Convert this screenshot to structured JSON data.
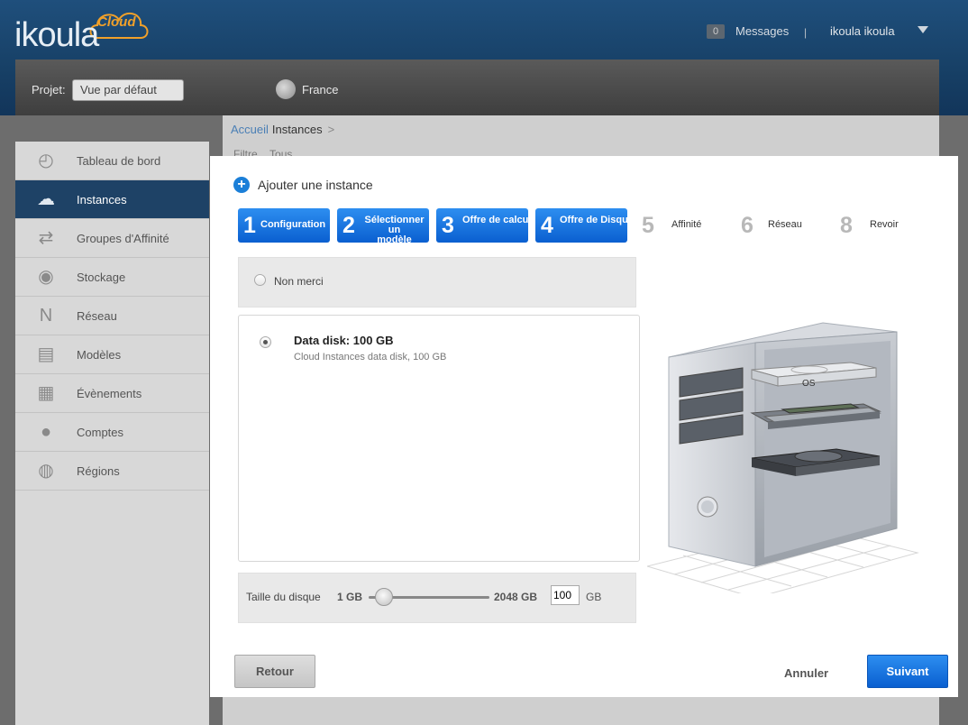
{
  "header": {
    "logo_text": "ikoula",
    "logo_cloud": "Cloud",
    "messages_count": "0",
    "messages_label": "Messages",
    "separator": "|",
    "user_name": "ikoula ikoula"
  },
  "project_bar": {
    "label": "Projet:",
    "selected": "Vue par défaut",
    "region": "France"
  },
  "sidebar": {
    "items": [
      {
        "label": "Tableau de bord",
        "icon": "dashboard-icon",
        "glyph": "◴"
      },
      {
        "label": "Instances",
        "icon": "cloud-icon",
        "glyph": "☁"
      },
      {
        "label": "Groupes d'Affinité",
        "icon": "affinity-icon",
        "glyph": "⇄"
      },
      {
        "label": "Stockage",
        "icon": "storage-icon",
        "glyph": "◉"
      },
      {
        "label": "Réseau",
        "icon": "network-icon",
        "glyph": "N"
      },
      {
        "label": "Modèles",
        "icon": "templates-icon",
        "glyph": "▤"
      },
      {
        "label": "Évènements",
        "icon": "calendar-icon",
        "glyph": "▦"
      },
      {
        "label": "Comptes",
        "icon": "user-icon",
        "glyph": "●"
      },
      {
        "label": "Régions",
        "icon": "globe-icon",
        "glyph": "◍"
      }
    ],
    "active_index": 1
  },
  "breadcrumb": {
    "home": "Accueil",
    "current": "Instances",
    "arrow": ">"
  },
  "background_toolbar": {
    "filter_label": "Filtre",
    "filter_value": "Tous"
  },
  "dialog": {
    "title": "Ajouter une instance",
    "steps": [
      {
        "num": "1",
        "label": "Configuration",
        "state": "done"
      },
      {
        "num": "2",
        "label": "Sélectionner un\nmodèle",
        "state": "done"
      },
      {
        "num": "3",
        "label": "Offre de calcul",
        "state": "done"
      },
      {
        "num": "4",
        "label": "Offre de Disque",
        "state": "done"
      },
      {
        "num": "5",
        "label": "Affinité",
        "state": "todo"
      },
      {
        "num": "6",
        "label": "Réseau",
        "state": "todo"
      },
      {
        "num": "8",
        "label": "Revoir",
        "state": "todo"
      }
    ],
    "no_thanks": "Non merci",
    "disk_name": "Data disk: 100 GB",
    "disk_desc": "Cloud Instances data disk, 100 GB",
    "size_label": "Taille du disque",
    "size_min": "1 GB",
    "size_max": "2048 GB",
    "size_value": "100",
    "size_unit": "GB",
    "slider_fraction": 0.048,
    "illustration_os": "OS",
    "back": "Retour",
    "cancel": "Annuler",
    "next": "Suivant"
  },
  "colors": {
    "accent_blue": "#0a5fd0",
    "header_blue": "#174066",
    "active_sidebar": "#1e4266"
  }
}
